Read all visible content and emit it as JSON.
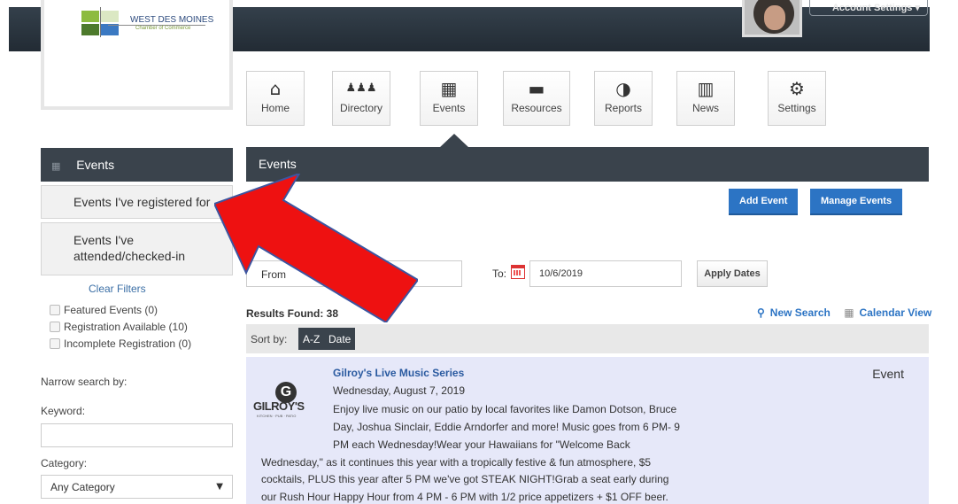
{
  "brand": {
    "name": "WEST DES MOINES",
    "sub": "Chamber of Commerce",
    "colors": {
      "green": "#8dbb3f",
      "blue": "#2c4a7d",
      "darkgreen": "#4d7a2c",
      "lightblue": "#3b79c2"
    }
  },
  "account": {
    "label": "Account Settings  ▾"
  },
  "nav": [
    {
      "label": "Home",
      "icon": "home-icon",
      "glyph": "⌂"
    },
    {
      "label": "Directory",
      "icon": "users-icon",
      "glyph": "♟♟♟"
    },
    {
      "label": "Events",
      "icon": "calendar-icon",
      "glyph": "▦"
    },
    {
      "label": "Resources",
      "icon": "folder-icon",
      "glyph": "▬"
    },
    {
      "label": "Reports",
      "icon": "pie-chart-icon",
      "glyph": "◑"
    },
    {
      "label": "News",
      "icon": "building-icon",
      "glyph": "▥"
    },
    {
      "label": "Settings",
      "icon": "gear-icon",
      "glyph": "⚙"
    }
  ],
  "sidebar": {
    "title": "Events",
    "items": [
      "Events I've registered for",
      "Events I've attended/checked-in"
    ],
    "clear_filters": "Clear Filters",
    "filters": [
      "Featured Events (0)",
      "Registration Available (10)",
      "Incomplete Registration (0)"
    ],
    "narrow_label": "Narrow search by:",
    "keyword_label": "Keyword:",
    "keyword_value": "",
    "category_label": "Category:",
    "category_value": "Any Category"
  },
  "main": {
    "title": "Events",
    "add_event": "Add Event",
    "manage_events": "Manage Events",
    "from_label": "From",
    "to_label": "To:",
    "to_value": "10/6/2019",
    "apply_dates": "Apply Dates",
    "results": "Results Found: 38",
    "new_search": "New Search",
    "calendar_view": "Calendar View",
    "sort_label": "Sort by:",
    "sort_options": [
      "A-Z",
      "Date"
    ]
  },
  "event": {
    "type": "Event",
    "title": "Gilroy's Live Music Series",
    "date": "Wednesday, August 7, 2019",
    "logo_name": "GILROY'S",
    "logo_tag": "KITCHEN · PUB · PATIO",
    "desc_lines": [
      "Enjoy live music on our patio by local favorites like Damon Dotson, Bruce",
      "Day, Joshua Sinclair, Eddie Arndorfer and more! Music goes from 6 PM- 9",
      "PM each Wednesday!Wear your Hawaiians for \"Welcome Back",
      "Wednesday,\" as it continues this year with a tropically festive & fun atmosphere, $5",
      "cocktails, PLUS this year after 5 PM we've got STEAK NIGHT!Grab a seat early during",
      "our Rush Hour Happy Hour from 4 PM - 6 PM with 1/2 price appetizers + $1 OFF beer."
    ]
  },
  "annotation": {
    "color": "#ee1111"
  }
}
